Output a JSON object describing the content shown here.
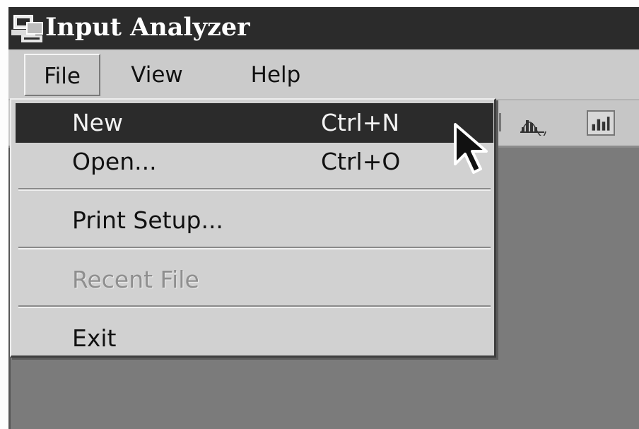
{
  "window": {
    "title": "Input Analyzer",
    "icon": "app-computer-icon"
  },
  "menubar": {
    "items": [
      {
        "label": "File"
      },
      {
        "label": "View"
      },
      {
        "label": "Help"
      }
    ]
  },
  "toolbar": {
    "buttons": [
      {
        "icon": "histogram-icon"
      },
      {
        "icon": "bar-chart-icon"
      }
    ]
  },
  "file_menu": {
    "items": [
      {
        "label": "New",
        "shortcut": "Ctrl+N",
        "highlighted": true
      },
      {
        "label": "Open...",
        "shortcut": "Ctrl+O"
      },
      {
        "label": "Print Setup..."
      },
      {
        "label": "Recent File",
        "disabled": true
      },
      {
        "label": "Exit"
      }
    ]
  },
  "colors": {
    "titlebar": "#2b2b2b",
    "menu_background": "#d1d1d1",
    "highlight": "#2b2b2b",
    "disabled_text": "#8f8f8f",
    "client_area": "#7b7b7b"
  }
}
